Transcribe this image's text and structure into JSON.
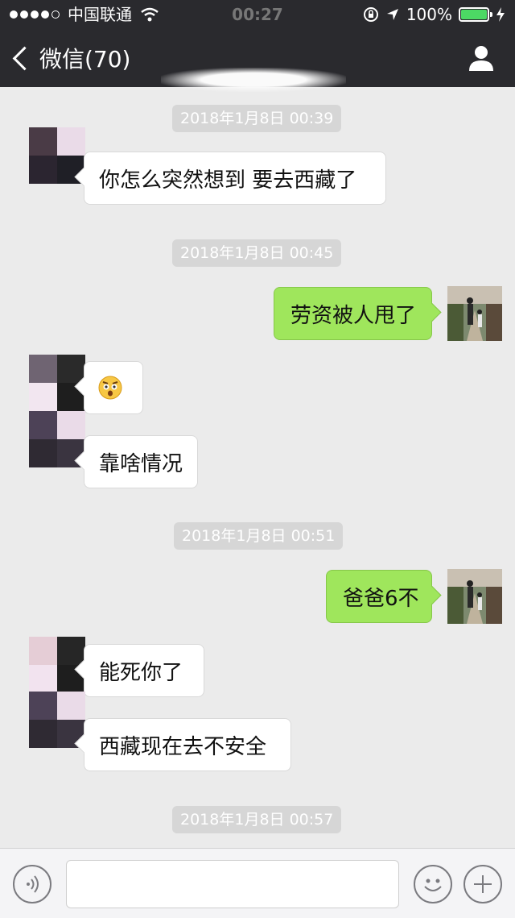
{
  "status_bar": {
    "carrier": "中国联通",
    "time": "00:27",
    "battery_percent": "100%",
    "battery_level": 1.0,
    "signal_bars_filled": 4,
    "signal_bars_total": 5,
    "icons": [
      "wifi-icon",
      "orientation-lock-icon",
      "location-arrow-icon",
      "battery-icon",
      "charging-icon"
    ]
  },
  "header": {
    "back_label": "微信(70)",
    "back_icon": "chevron-left-icon",
    "profile_icon": "person-icon",
    "background": "#2a2a2e"
  },
  "messages": [
    {
      "type": "time",
      "text": "2018年1月8日 00:39"
    },
    {
      "type": "received",
      "text": "你怎么突然想到 要去西藏了"
    },
    {
      "type": "time",
      "text": "2018年1月8日 00:45"
    },
    {
      "type": "sent",
      "text": "劳资被人甩了"
    },
    {
      "type": "received",
      "emoji": "surprised-face-emoji"
    },
    {
      "type": "received",
      "text": "靠啥情况"
    },
    {
      "type": "time",
      "text": "2018年1月8日 00:51"
    },
    {
      "type": "sent",
      "text": "爸爸6不"
    },
    {
      "type": "received",
      "text": "能死你了"
    },
    {
      "type": "received",
      "text": "西藏现在去不安全"
    },
    {
      "type": "time",
      "text": "2018年1月8日 00:57"
    }
  ],
  "input_bar": {
    "voice_icon": "voice-icon",
    "emoji_icon": "emoji-smile-icon",
    "plus_icon": "plus-icon",
    "input_value": ""
  },
  "colors": {
    "chat_background": "#ebebeb",
    "sent_bubble": "#9fe65c",
    "received_bubble": "#ffffff",
    "timestamp_pill": "#d6d6d6"
  }
}
